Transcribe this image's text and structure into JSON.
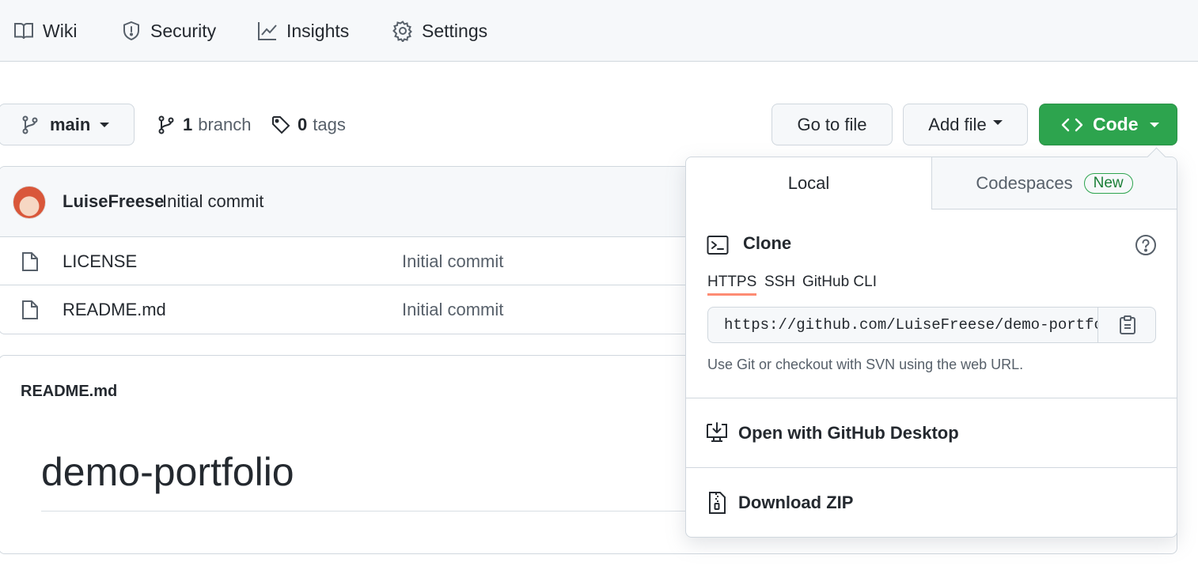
{
  "nav": {
    "items": [
      {
        "label": "Wiki",
        "icon": "book-icon"
      },
      {
        "label": "Security",
        "icon": "shield-icon"
      },
      {
        "label": "Insights",
        "icon": "graph-icon"
      },
      {
        "label": "Settings",
        "icon": "gear-icon"
      }
    ]
  },
  "repo": {
    "branch_selector": "main",
    "branch_count": "1",
    "branch_label": "branch",
    "tag_count": "0",
    "tag_label": "tags",
    "go_to_file": "Go to file",
    "add_file": "Add file",
    "code": "Code"
  },
  "commit": {
    "author": "LuiseFreese",
    "message": "Initial commit"
  },
  "files": [
    {
      "name": "LICENSE",
      "commit": "Initial commit"
    },
    {
      "name": "README.md",
      "commit": "Initial commit"
    }
  ],
  "readme": {
    "label": "README.md",
    "heading": "demo-portfolio"
  },
  "code_dropdown": {
    "tab_local": "Local",
    "tab_codespaces": "Codespaces",
    "badge_new": "New",
    "clone_title": "Clone",
    "subtabs": [
      "HTTPS",
      "SSH",
      "GitHub CLI"
    ],
    "active_subtab": "HTTPS",
    "clone_url": "https://github.com/LuiseFreese/demo-portfolio.git",
    "url_hint": "Use Git or checkout with SVN using the web URL.",
    "open_desktop": "Open with GitHub Desktop",
    "download_zip": "Download ZIP"
  },
  "colors": {
    "accent_green": "#2da44e",
    "subtab_underline": "#fd8c73",
    "border": "#d0d7de",
    "muted_text": "#57606a"
  }
}
